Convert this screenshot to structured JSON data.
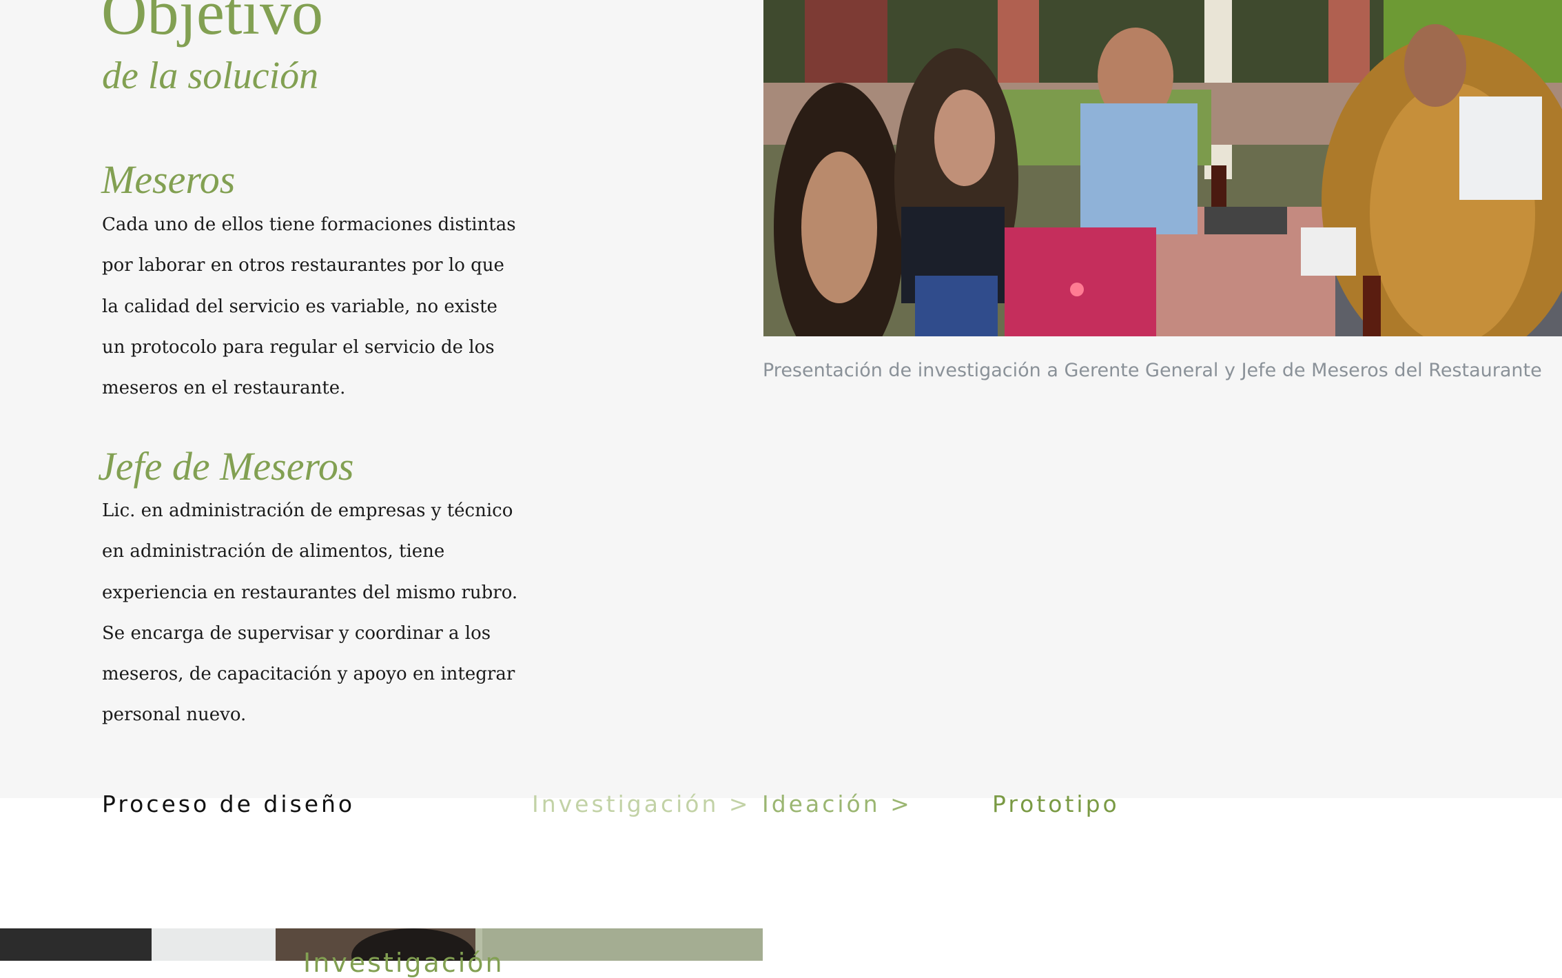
{
  "colors": {
    "accent": "#82a052",
    "body_text": "#1a1a1a",
    "caption": "#8a9198",
    "background": "#f6f6f6"
  },
  "objective": {
    "title": "Objetivo",
    "subtitle": "de la solución"
  },
  "meseros": {
    "title": "Meseros",
    "text": "Cada uno de ellos tiene formaciones distintas por laborar en otros restaurantes por lo que la calidad del servicio es variable, no existe un protocolo para regular el servicio de los meseros en el restaurante."
  },
  "jefe": {
    "title": "Jefe de Meseros",
    "text": "Lic. en administración de empresas y técnico en administración de alimentos, tiene experiencia en restaurantes del mismo rubro. Se encarga de supervisar y coordinar a los meseros, de capacitación y apoyo en integrar personal nuevo."
  },
  "photo": {
    "caption": "Presentación de investigación a Gerente General y Jefe de Meseros del Restaurante"
  },
  "process": {
    "title": "Proceso de diseño",
    "steps": [
      "Investigación >",
      "Ideación >",
      "Prototipo"
    ]
  },
  "next_section": {
    "title_partial": "Investigación"
  }
}
